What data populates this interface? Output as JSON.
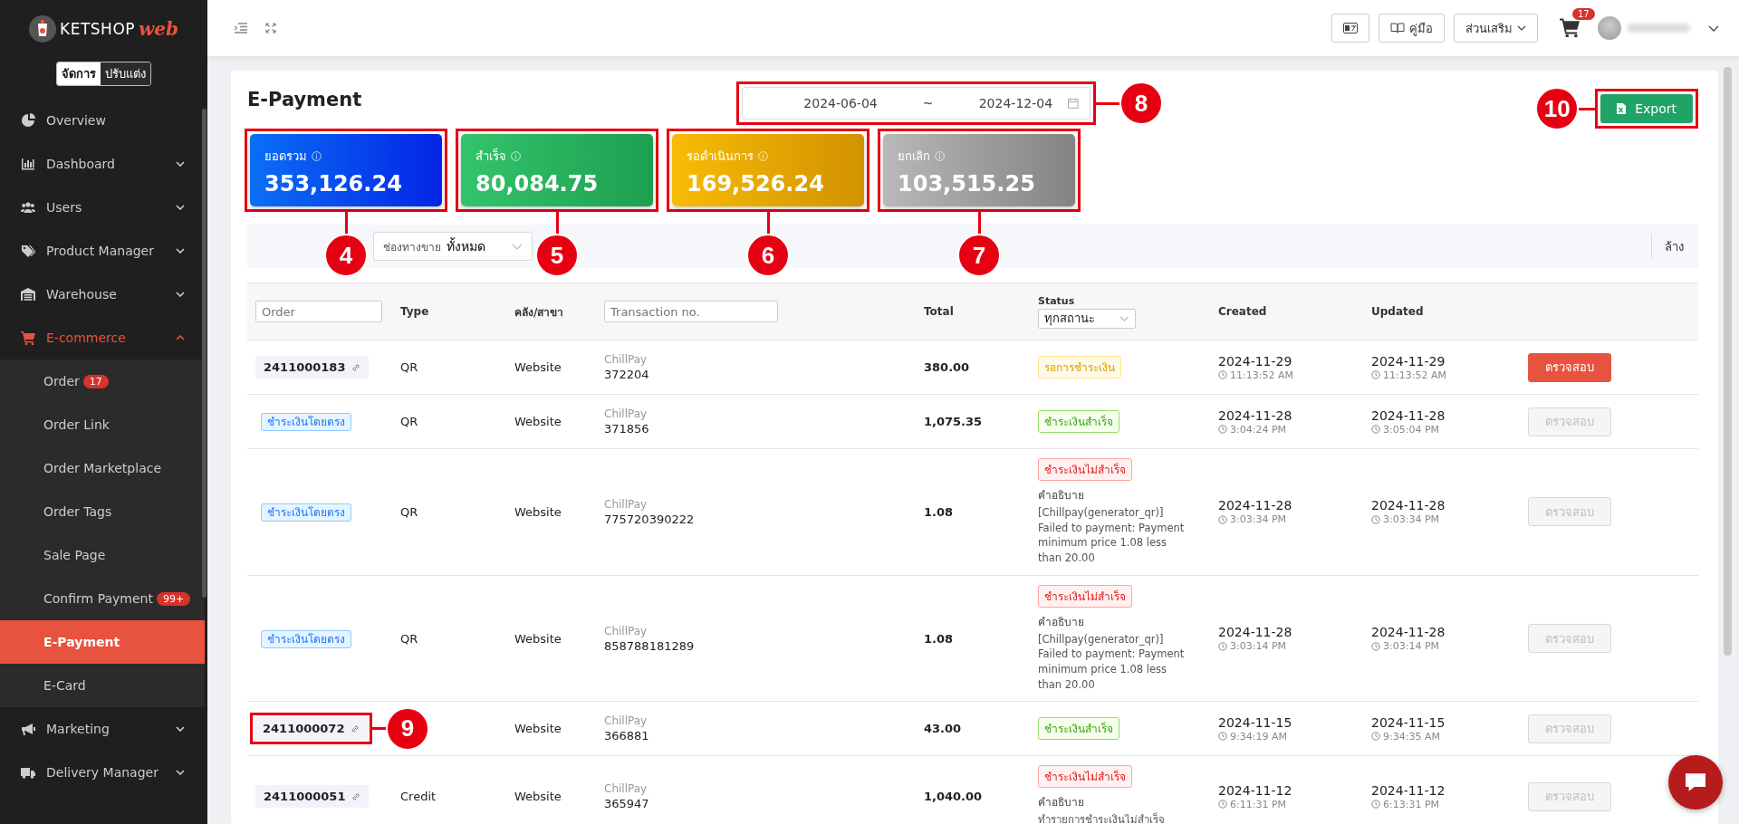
{
  "brand": {
    "name": "KETSHOP",
    "suffix": "web"
  },
  "mode_toggle": [
    {
      "label": "จัดการ",
      "selected": true
    },
    {
      "label": "ปรับแต่ง",
      "selected": false
    }
  ],
  "sidebar": {
    "items": [
      {
        "label": "Overview",
        "expandable": false,
        "selected": false
      },
      {
        "label": "Dashboard",
        "expandable": true,
        "expanded": false,
        "selected": false
      },
      {
        "label": "Users",
        "expandable": true,
        "expanded": false,
        "selected": false
      },
      {
        "label": "Product Manager",
        "expandable": true,
        "expanded": false,
        "selected": false
      },
      {
        "label": "Warehouse",
        "expandable": true,
        "expanded": false,
        "selected": false
      },
      {
        "label": "E-commerce",
        "expandable": true,
        "expanded": true,
        "selected": true,
        "children": [
          {
            "label": "Order",
            "badge": "17",
            "selected": false
          },
          {
            "label": "Order Link",
            "selected": false
          },
          {
            "label": "Order Marketplace",
            "selected": false
          },
          {
            "label": "Order Tags",
            "selected": false
          },
          {
            "label": "Sale Page",
            "selected": false
          },
          {
            "label": "Confirm Payment",
            "badge": "99+",
            "selected": false
          },
          {
            "label": "E-Payment",
            "selected": true
          },
          {
            "label": "E-Card",
            "selected": false
          }
        ]
      },
      {
        "label": "Marketing",
        "expandable": true,
        "expanded": false,
        "selected": false
      },
      {
        "label": "Delivery Manager",
        "expandable": true,
        "expanded": false,
        "selected": false
      }
    ]
  },
  "header": {
    "guide": "คู่มือ",
    "addons": "ส่วนเสริม",
    "cart_count": "17"
  },
  "page": {
    "title": "E-Payment",
    "date_range": {
      "start": "2024-06-04",
      "separator": "~",
      "end": "2024-12-04",
      "callout": "8"
    },
    "export": {
      "label": "Export",
      "callout": "10"
    }
  },
  "summary_cards": [
    {
      "kind": "total",
      "label": "ยอดรวม",
      "value": "353,126.24",
      "callout": "4"
    },
    {
      "kind": "success",
      "label": "สำเร็จ",
      "value": "80,084.75",
      "callout": "5"
    },
    {
      "kind": "pending",
      "label": "รอดำเนินการ",
      "value": "169,526.24",
      "callout": "6"
    },
    {
      "kind": "cancel",
      "label": "ยกเลิก",
      "value": "103,515.25",
      "callout": "7"
    }
  ],
  "filter": {
    "label": "ช่องทางขาย",
    "value": "ทั้งหมด",
    "clear": "ล้าง"
  },
  "table": {
    "columns": {
      "order_placeholder": "Order",
      "type": "Type",
      "warehouse": "คลัง/สาขา",
      "transaction_placeholder": "Transaction no.",
      "total": "Total",
      "status": "Status",
      "status_filter": "ทุกสถานะ",
      "created": "Created",
      "updated": "Updated"
    },
    "rows": [
      {
        "order": {
          "kind": "order",
          "text": "2411000183"
        },
        "type": "QR",
        "warehouse": "Website",
        "provider": "ChillPay",
        "transaction": "372204",
        "total": "380.00",
        "status": {
          "kind": "pending",
          "label": "รอการชำระเงิน"
        },
        "created": {
          "date": "2024-11-29",
          "time": "11:13:52 AM"
        },
        "updated": {
          "date": "2024-11-29",
          "time": "11:13:52 AM"
        },
        "action": {
          "label": "ตรวจสอบ",
          "disabled": false
        }
      },
      {
        "order": {
          "kind": "direct",
          "text": "ชำระเงินโดยตรง"
        },
        "type": "QR",
        "warehouse": "Website",
        "provider": "ChillPay",
        "transaction": "371856",
        "total": "1,075.35",
        "status": {
          "kind": "success",
          "label": "ชำระเงินสำเร็จ"
        },
        "created": {
          "date": "2024-11-28",
          "time": "3:04:24 PM"
        },
        "updated": {
          "date": "2024-11-28",
          "time": "3:05:04 PM"
        },
        "action": {
          "label": "ตรวจสอบ",
          "disabled": true
        }
      },
      {
        "order": {
          "kind": "direct",
          "text": "ชำระเงินโดยตรง"
        },
        "type": "QR",
        "warehouse": "Website",
        "provider": "ChillPay",
        "transaction": "775720390222",
        "total": "1.08",
        "status": {
          "kind": "failed",
          "label": "ชำระเงินไม่สำเร็จ"
        },
        "description": {
          "label": "คำอธิบาย",
          "text": "[Chillpay(generator_qr)] Failed to payment: Payment minimum price 1.08 less than 20.00"
        },
        "created": {
          "date": "2024-11-28",
          "time": "3:03:34 PM"
        },
        "updated": {
          "date": "2024-11-28",
          "time": "3:03:34 PM"
        },
        "action": {
          "label": "ตรวจสอบ",
          "disabled": true
        }
      },
      {
        "order": {
          "kind": "direct",
          "text": "ชำระเงินโดยตรง"
        },
        "type": "QR",
        "warehouse": "Website",
        "provider": "ChillPay",
        "transaction": "858788181289",
        "total": "1.08",
        "status": {
          "kind": "failed",
          "label": "ชำระเงินไม่สำเร็จ"
        },
        "description": {
          "label": "คำอธิบาย",
          "text": "[Chillpay(generator_qr)] Failed to payment: Payment minimum price 1.08 less than 20.00"
        },
        "created": {
          "date": "2024-11-28",
          "time": "3:03:14 PM"
        },
        "updated": {
          "date": "2024-11-28",
          "time": "3:03:14 PM"
        },
        "action": {
          "label": "ตรวจสอบ",
          "disabled": true
        }
      },
      {
        "order": {
          "kind": "order",
          "text": "2411000072",
          "callout": "9"
        },
        "warehouse": "Website",
        "provider": "ChillPay",
        "transaction": "366881",
        "total": "43.00",
        "status": {
          "kind": "success",
          "label": "ชำระเงินสำเร็จ"
        },
        "created": {
          "date": "2024-11-15",
          "time": "9:34:19 AM"
        },
        "updated": {
          "date": "2024-11-15",
          "time": "9:34:35 AM"
        },
        "action": {
          "label": "ตรวจสอบ",
          "disabled": true
        }
      },
      {
        "order": {
          "kind": "order",
          "text": "2411000051"
        },
        "type": "Credit",
        "warehouse": "Website",
        "provider": "ChillPay",
        "transaction": "365947",
        "total": "1,040.00",
        "status": {
          "kind": "failed",
          "label": "ชำระเงินไม่สำเร็จ"
        },
        "description": {
          "label": "คำอธิบาย",
          "text": "ทำรายการชำระเงินไม่สำเร็จ"
        },
        "created": {
          "date": "2024-11-12",
          "time": "6:11:31 PM"
        },
        "updated": {
          "date": "2024-11-12",
          "time": "6:13:31 PM"
        },
        "action": {
          "label": "ตรวจสอบ",
          "disabled": true
        }
      }
    ]
  }
}
